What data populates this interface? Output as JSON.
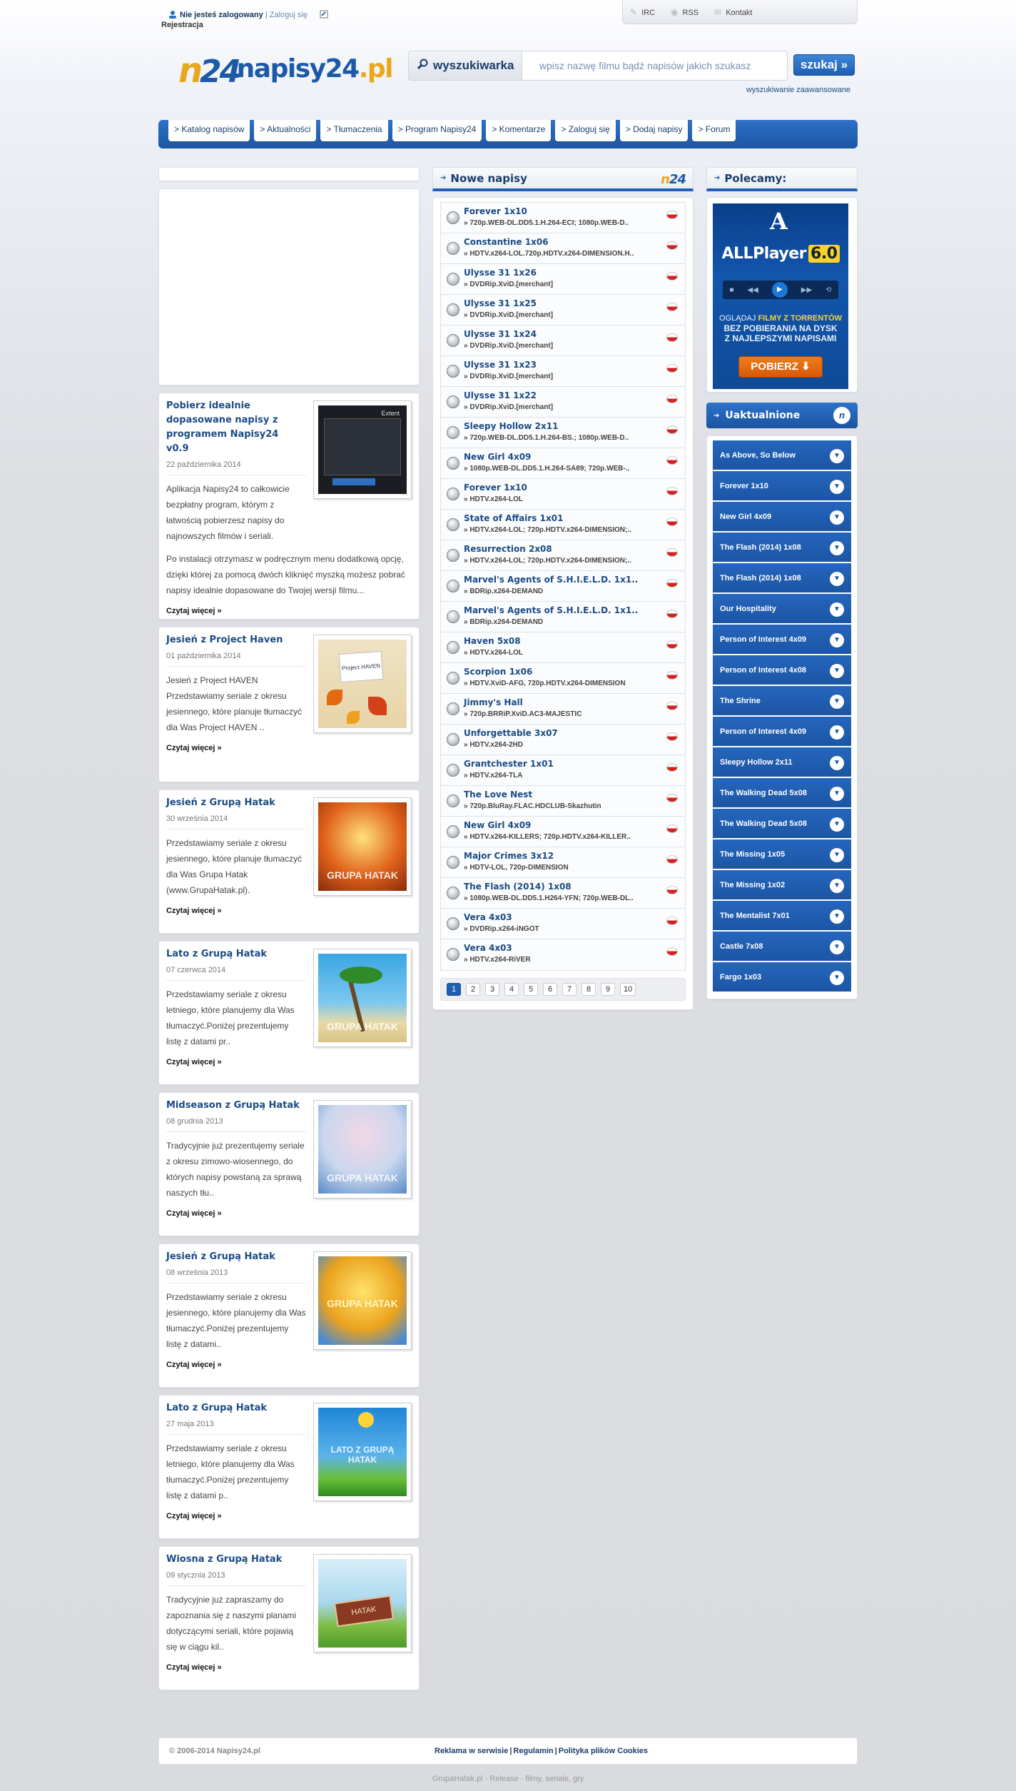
{
  "topbar": {
    "status": "Nie jesteś zalogowany",
    "separator": "|",
    "login": "Zaloguj się",
    "register": "Rejestracja",
    "links": [
      "IRC",
      "RSS",
      "Kontakt"
    ]
  },
  "header": {
    "logo_mark_n": "n",
    "logo_mark_num": "24",
    "logo_text": "napisy24",
    "logo_tld": ".pl",
    "search_tab": "wyszukiwarka",
    "search_placeholder": "wpisz nazwę filmu bądź napisów jakich szukasz",
    "search_button": "szukaj",
    "advanced": "wyszukiwanie zaawansowane"
  },
  "nav": [
    "> Katalog napisów",
    "> Aktualności",
    "> Tłumaczenia",
    "> Program Napisy24",
    "> Komentarze",
    "> Zaloguj się",
    "> Dodaj napisy",
    "> Forum"
  ],
  "news": [
    {
      "title": "Pobierz idealnie dopasowane napisy z programem Napisy24 v0.9",
      "date": "22 października 2014",
      "body": "Aplikacja Napisy24 to całkowicie bezpłatny program, którym z łatwością pobierzesz napisy do najnowszych filmów i seriali.",
      "body2": "Po instalacji otrzymasz w podręcznym menu dodatkową opcję, dzięki której za pomocą dwóch kliknięć myszką możesz pobrać napisy idealnie dopasowane do Twojej wersji filmu...",
      "more": "Czytaj więcej »"
    },
    {
      "title": "Jesień z Project Haven",
      "date": "01 października 2014",
      "body": "Jesień z Project HAVEN Przedstawiamy seriale z okresu jesiennego, które planuje tłumaczyć dla Was Project HAVEN ..",
      "more": "Czytaj więcej »"
    },
    {
      "title": "Jesień z Grupą Hatak",
      "date": "30 września 2014",
      "body": "Przedstawiamy seriale z okresu jesiennego, które planuje tłumaczyć dla Was Grupa Hatak (www.GrupaHatak.pl).",
      "more": "Czytaj więcej »"
    },
    {
      "title": "Lato z Grupą Hatak",
      "date": "07 czerwca 2014",
      "body": "Przedstawiamy seriale z okresu letniego, które planujemy dla Was tłumaczyć.Poniżej prezentujemy listę z datami pr..",
      "more": "Czytaj więcej »"
    },
    {
      "title": "Midseason z Grupą Hatak",
      "date": "08 grudnia 2013",
      "body": "Tradycyjnie już prezentujemy seriale z okresu zimowo-wiosennego, do których napisy powstaną za sprawą naszych tłu..",
      "more": "Czytaj więcej »"
    },
    {
      "title": "Jesień z Grupą Hatak",
      "date": "08 września 2013",
      "body": "Przedstawiamy seriale z okresu jesiennego, które planujemy dla Was tłumaczyć.Poniżej prezentujemy listę z datami..",
      "more": "Czytaj więcej »"
    },
    {
      "title": "Lato z Grupą Hatak",
      "date": "27 maja 2013",
      "body": "Przedstawiamy seriale z okresu letniego, które planujemy dla Was tłumaczyć.Poniżej prezentujemy listę z datami p..",
      "more": "Czytaj więcej »"
    },
    {
      "title": "Wiosna z Grupą Hatak",
      "date": "09 stycznia 2013",
      "body": "Tradycyjnie już zapraszamy do zapoznania się z naszymi planami dotyczącymi seriali, które pojawią się w ciągu kil..",
      "more": "Czytaj więcej »"
    }
  ],
  "thumbs": [
    "Extent",
    "Project HAVEN",
    "GRUPA HATAK",
    "GRUPA HATAK",
    "GRUPA HATAK",
    "GRUPA HATAK",
    "LATO Z GRUPĄ HATAK",
    "HATAK"
  ],
  "new_subs": {
    "title": "Nowe napisy",
    "items": [
      {
        "title": "Forever 1x10",
        "rel": "» 720p.WEB-DL.DD5.1.H.264-ECI; 1080p.WEB-D.."
      },
      {
        "title": "Constantine 1x06",
        "rel": "» HDTV.x264-LOL.720p.HDTV.x264-DIMENSION.H.."
      },
      {
        "title": "Ulysse 31 1x26",
        "rel": "» DVDRip.XviD.[merchant]"
      },
      {
        "title": "Ulysse 31 1x25",
        "rel": "» DVDRip.XviD.[merchant]"
      },
      {
        "title": "Ulysse 31 1x24",
        "rel": "» DVDRip.XviD.[merchant]"
      },
      {
        "title": "Ulysse 31 1x23",
        "rel": "» DVDRip.XviD.[merchant]"
      },
      {
        "title": "Ulysse 31 1x22",
        "rel": "» DVDRip.XviD.[merchant]"
      },
      {
        "title": "Sleepy Hollow 2x11",
        "rel": "» 720p.WEB-DL.DD5.1.H.264-BS.; 1080p.WEB-D.."
      },
      {
        "title": "New Girl 4x09",
        "rel": "» 1080p.WEB-DL.DD5.1.H.264-SA89; 720p.WEB-.."
      },
      {
        "title": "Forever 1x10",
        "rel": "» HDTV.x264-LOL"
      },
      {
        "title": "State of Affairs 1x01",
        "rel": "» HDTV.x264-LOL; 720p.HDTV.x264-DIMENSION;.."
      },
      {
        "title": "Resurrection 2x08",
        "rel": "» HDTV.x264-LOL; 720p.HDTV.x264-DIMENSION;.."
      },
      {
        "title": "Marvel's Agents of S.H.I.E.L.D. 1x1..",
        "rel": "» BDRip.x264-DEMAND"
      },
      {
        "title": "Marvel's Agents of S.H.I.E.L.D. 1x1..",
        "rel": "» BDRip.x264-DEMAND"
      },
      {
        "title": "Haven 5x08",
        "rel": "» HDTV.x264-LOL"
      },
      {
        "title": "Scorpion 1x06",
        "rel": "» HDTV.XviD-AFG, 720p.HDTV.x264-DIMENSION"
      },
      {
        "title": "Jimmy's Hall",
        "rel": "» 720p.BRRiP.XviD.AC3-MAJESTIC"
      },
      {
        "title": "Unforgettable 3x07",
        "rel": "» HDTV.x264-2HD"
      },
      {
        "title": "Grantchester 1x01",
        "rel": "» HDTV.x264-TLA"
      },
      {
        "title": "The Love Nest",
        "rel": "» 720p.BluRay.FLAC.HDCLUB-Skazhutin"
      },
      {
        "title": "New Girl 4x09",
        "rel": "» HDTV.x264-KILLERS; 720p.HDTV.x264-KILLER.."
      },
      {
        "title": "Major Crimes 3x12",
        "rel": "» HDTV-LOL, 720p-DIMENSION"
      },
      {
        "title": "The Flash (2014) 1x08",
        "rel": "» 1080p.WEB-DL.DD5.1.H264-YFN; 720p.WEB-DL.."
      },
      {
        "title": "Vera 4x03",
        "rel": "» DVDRip.x264-iNGOT"
      },
      {
        "title": "Vera 4x03",
        "rel": "» HDTV.x264-RiVER"
      }
    ],
    "pages": [
      "1",
      "2",
      "3",
      "4",
      "5",
      "6",
      "7",
      "8",
      "9",
      "10"
    ],
    "active_page": "1"
  },
  "recommend": {
    "title": "Polecamy:",
    "promo_logo": "A",
    "promo_brand": "ALLPlayer",
    "promo_version": "6.0",
    "promo_line1": "OGLĄDAJ",
    "promo_line1b": "FILMY Z TORRENTÓW",
    "promo_line2": "BEZ POBIERANIA NA DYSK",
    "promo_line3": "Z NAJLEPSZYMI NAPISAMI",
    "promo_button": "POBIERZ"
  },
  "updated": {
    "title": "Uaktualnione",
    "badge": "n",
    "items": [
      "As Above, So Below",
      "Forever 1x10",
      "New Girl 4x09",
      "The Flash (2014) 1x08",
      "The Flash (2014) 1x08",
      "Our Hospitality",
      "Person of Interest 4x09",
      "Person of Interest 4x08",
      "The Shrine",
      "Person of Interest 4x09",
      "Sleepy Hollow 2x11",
      "The Walking Dead 5x08",
      "The Walking Dead 5x08",
      "The Missing 1x05",
      "The Missing 1x02",
      "The Mentalist 7x01",
      "Castle 7x08",
      "Fargo 1x03"
    ]
  },
  "footer": {
    "copyright": "© 2006-2014 Napisy24.pl",
    "links": [
      "Reklama w serwisie",
      "Regulamin",
      "Polityka plików Cookies"
    ],
    "bottom": "GrupaHatak.pl · Release - filmy, seriale, gry"
  },
  "colors": {
    "accent": "#1f5fb2",
    "brand_orange": "#e8a81c",
    "title_blue": "#1b4b85"
  }
}
